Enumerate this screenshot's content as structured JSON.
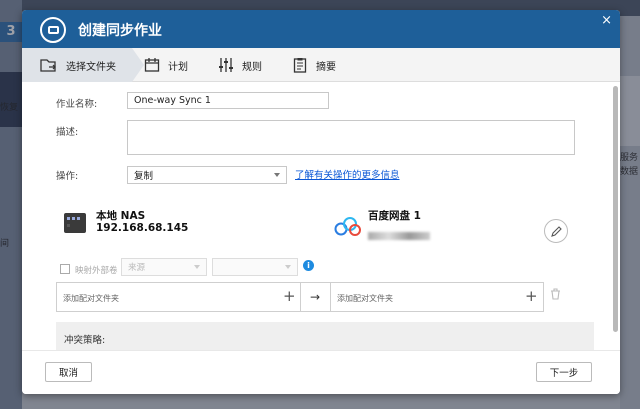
{
  "background": {
    "left_number": "3",
    "left_text_1": "恢复",
    "left_text_2": "间",
    "right_text_1": "云服务",
    "right_text_2": "数据"
  },
  "dialog": {
    "title": "创建同步作业",
    "close_symbol": "×"
  },
  "steps": [
    {
      "label": "选择文件夹",
      "icon": "folder-sync-icon",
      "active": true
    },
    {
      "label": "计划",
      "icon": "calendar-icon",
      "active": false
    },
    {
      "label": "规则",
      "icon": "sliders-icon",
      "active": false
    },
    {
      "label": "摘要",
      "icon": "clipboard-icon",
      "active": false
    }
  ],
  "form": {
    "job_name_label": "作业名称:",
    "job_name_value": "One-way Sync 1",
    "description_label": "描述:",
    "description_value": "",
    "operation_label": "操作:",
    "operation_value": "复制",
    "operation_link": "了解有关操作的更多信息"
  },
  "source": {
    "title": "本地 NAS",
    "address": "192.168.68.145",
    "icon": "nas-icon"
  },
  "destination": {
    "title": "百度网盘 1",
    "icon": "baidu-netdisk-icon"
  },
  "mapping": {
    "checkbox_label": "映射外部卷",
    "source_select": "来源",
    "target_select": "",
    "add_local_folder": "添加配对文件夹",
    "add_remote_folder": "添加配对文件夹",
    "plus": "+",
    "arrow": "→"
  },
  "conflict": {
    "title": "冲突策略:"
  },
  "buttons": {
    "cancel": "取消",
    "next": "下一步"
  },
  "colors": {
    "title_bar": "#1e5f99",
    "link": "#0a57d6",
    "info": "#1e8be0"
  }
}
